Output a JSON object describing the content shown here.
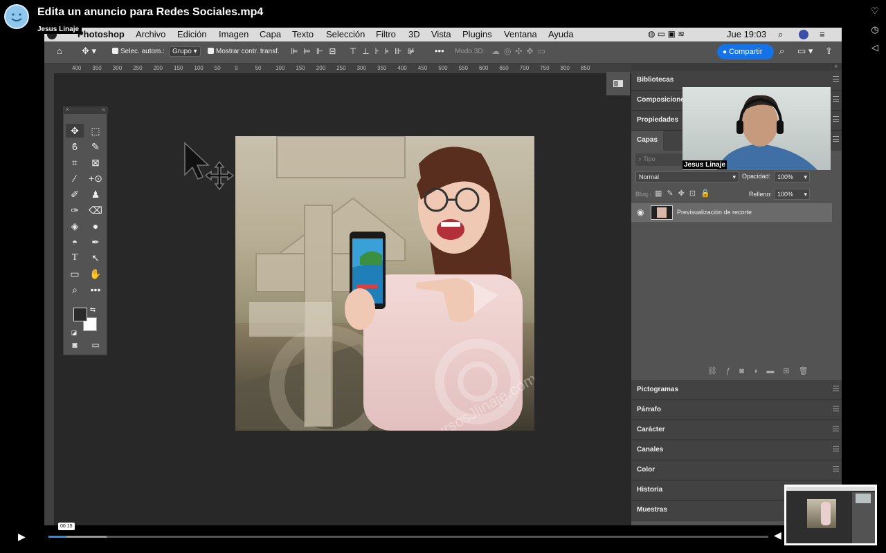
{
  "video": {
    "title": "Edita un anuncio para Redes Sociales.mp4",
    "author": "Jesus Linaje",
    "timestamp": "00:15",
    "side_icons": [
      "heart-icon",
      "clock-icon",
      "send-icon"
    ]
  },
  "menubar": {
    "app": "Photoshop",
    "items": [
      "Archivo",
      "Edición",
      "Imagen",
      "Capa",
      "Texto",
      "Selección",
      "Filtro",
      "3D",
      "Vista",
      "Plugins",
      "Ventana",
      "Ayuda"
    ],
    "clock": "Jue 19:03"
  },
  "options": {
    "auto_select_label": "Selec. autom.:",
    "auto_select_value": "Grupo",
    "show_transform_label": "Mostrar contr. transf.",
    "mode3d_label": "Modo 3D:",
    "share_label": "Compartir"
  },
  "rulers": {
    "h_ticks": [
      "400",
      "350",
      "300",
      "250",
      "200",
      "150",
      "100",
      "50",
      "0",
      "50",
      "100",
      "150",
      "200",
      "250",
      "300",
      "350",
      "400",
      "450",
      "500",
      "550",
      "600",
      "650",
      "700",
      "750",
      "800",
      "850"
    ]
  },
  "panels": {
    "top_tabs": [
      "Bibliotecas",
      "Composiciones",
      "Propiedades"
    ],
    "layers_tab": "Capas",
    "search_placeholder": "Tipo",
    "blend_mode": "Normal",
    "opacity_label": "Opacidad:",
    "opacity_value": "100%",
    "lock_label": "Bloq.:",
    "fill_label": "Relleno:",
    "fill_value": "100%",
    "layer_name": "Previsualización de recorte",
    "bottom_tabs": [
      "Pictogramas",
      "Párrafo",
      "Carácter",
      "Canales",
      "Color",
      "Historia",
      "Muestras"
    ]
  },
  "webcam": {
    "name": "Jesus Linaje"
  },
  "watermark": "cursosJlinaje.com"
}
